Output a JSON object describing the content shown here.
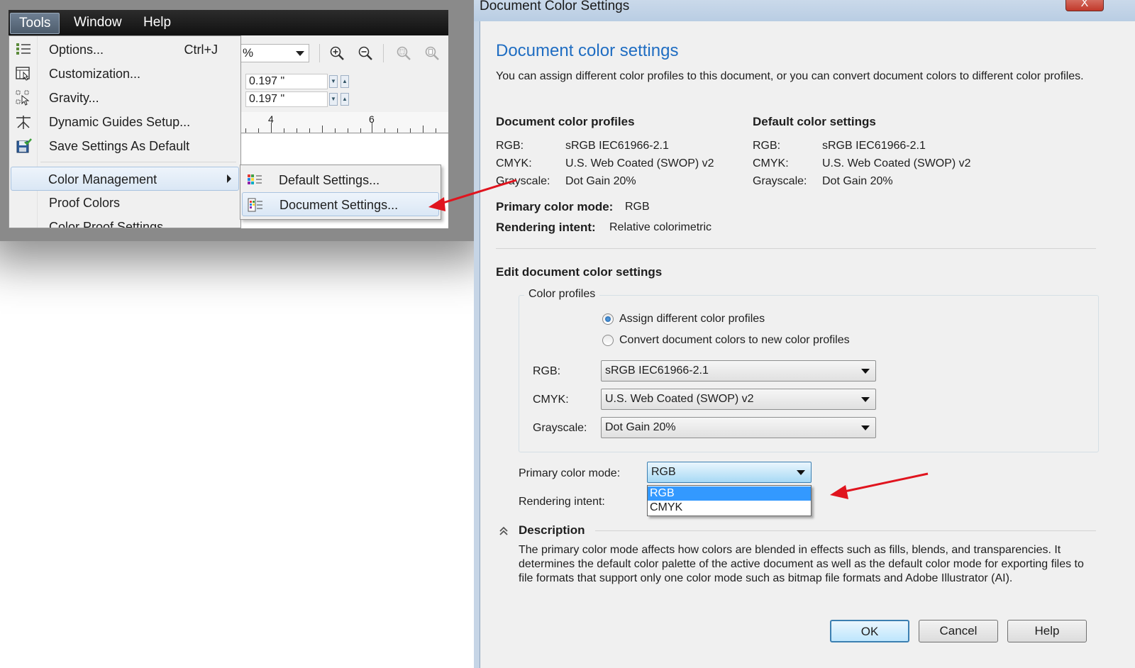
{
  "app": {
    "menubar": [
      "Tools",
      "Window",
      "Help"
    ],
    "toolbar": {
      "zoom_combo_value": "%",
      "coord_x": "0.197 \"",
      "coord_y": "0.197 \"",
      "ruler_labels": [
        "4",
        "6"
      ]
    },
    "tools_menu": {
      "items": [
        {
          "label": "Options...",
          "shortcut": "Ctrl+J",
          "icon": "options-icon"
        },
        {
          "label": "Customization...",
          "icon": "customization-icon"
        },
        {
          "label": "Gravity...",
          "icon": "gravity-icon"
        },
        {
          "label": "Dynamic Guides Setup...",
          "icon": "dynamic-guides-icon"
        },
        {
          "label": "Save Settings As Default",
          "icon": "save-settings-icon"
        },
        {
          "label": "Color Management"
        },
        {
          "label": "Proof Colors"
        },
        {
          "label": "Color Proof Settings"
        }
      ]
    },
    "color_management_submenu": [
      {
        "label": "Default Settings...",
        "icon": "default-settings-icon"
      },
      {
        "label": "Document Settings...",
        "icon": "document-settings-icon"
      }
    ]
  },
  "dialog": {
    "title": "Document Color Settings",
    "close_label": "X",
    "heading": "Document color settings",
    "intro": "You can assign different color profiles to this document, or you can convert document colors to different color profiles.",
    "document_profiles": {
      "title": "Document color profiles",
      "rows": [
        {
          "label": "RGB:",
          "value": "sRGB IEC61966-2.1"
        },
        {
          "label": "CMYK:",
          "value": "U.S. Web Coated (SWOP) v2"
        },
        {
          "label": "Grayscale:",
          "value": "Dot Gain 20%"
        }
      ]
    },
    "default_settings": {
      "title": "Default color settings",
      "rows": [
        {
          "label": "RGB:",
          "value": "sRGB IEC61966-2.1"
        },
        {
          "label": "CMYK:",
          "value": "U.S. Web Coated (SWOP) v2"
        },
        {
          "label": "Grayscale:",
          "value": "Dot Gain 20%"
        }
      ]
    },
    "primary_mode_label": "Primary color mode:",
    "primary_mode_value": "RGB",
    "rendering_intent_label": "Rendering intent:",
    "rendering_intent_value": "Relative colorimetric",
    "edit_title": "Edit document color settings",
    "profiles_group": {
      "legend": "Color profiles",
      "radio_assign": "Assign different color profiles",
      "radio_convert": "Convert document colors to new color profiles",
      "rgb_label": "RGB:",
      "rgb_value": "sRGB IEC61966-2.1",
      "cmyk_label": "CMYK:",
      "cmyk_value": "U.S. Web Coated (SWOP) v2",
      "gray_label": "Grayscale:",
      "gray_value": "Dot Gain 20%"
    },
    "edit_primary_mode_label": "Primary color mode:",
    "edit_primary_mode_value": "RGB",
    "mode_options": [
      "RGB",
      "CMYK"
    ],
    "edit_rendering_intent_label": "Rendering intent:",
    "description_title": "Description",
    "description": "The primary color mode affects how colors are blended in effects such as fills, blends, and transparencies. It determines the default color palette of the active document as well as the default color mode for exporting files to file formats that support only one color mode such as bitmap file formats and Adobe Illustrator (AI).",
    "buttons": {
      "ok": "OK",
      "cancel": "Cancel",
      "help": "Help"
    }
  },
  "colors": {
    "heading_blue": "#1f6dc2",
    "annotation_red": "#e0141e",
    "selection_blue": "#3399ff"
  }
}
